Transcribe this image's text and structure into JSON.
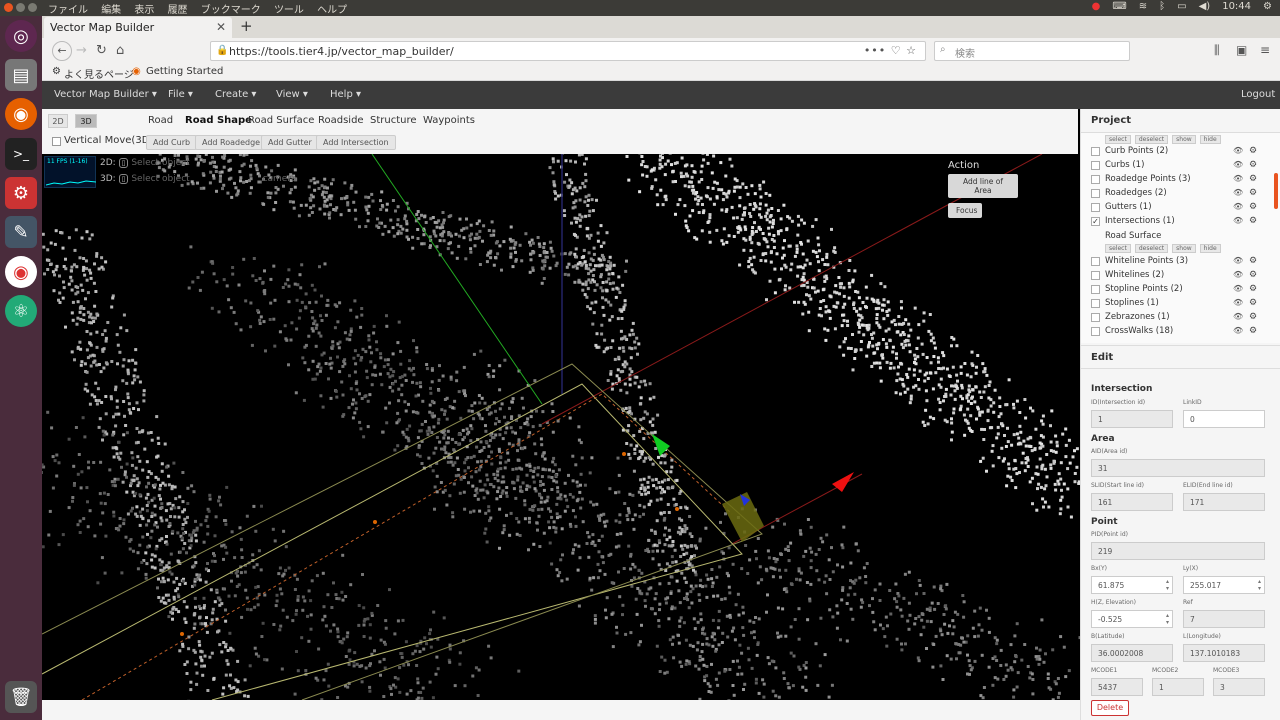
{
  "system": {
    "menu": [
      "ファイル",
      "編集",
      "表示",
      "履歴",
      "ブックマーク",
      "ツール",
      "ヘルプ"
    ],
    "time": "10:44"
  },
  "browser": {
    "tab_title": "Vector Map Builder",
    "url": "https://tools.tier4.jp/vector_map_builder/",
    "search_placeholder": "検索",
    "bookmarks": [
      "よく見るページ",
      "Getting Started"
    ]
  },
  "appnav": {
    "brand": "Vector Map Builder",
    "items": [
      "File",
      "Create",
      "View",
      "Help"
    ],
    "logout": "Logout"
  },
  "toolbar": {
    "view_2d": "2D",
    "view_3d": "3D",
    "tabs": [
      "Road",
      "Road Shape",
      "Road Surface",
      "Roadside",
      "Structure",
      "Waypoints"
    ],
    "active_tab": "Road Shape",
    "vertical_move": "Vertical Move(3D)",
    "sub_buttons": [
      "Add Curb",
      "Add Roadedge",
      "Add Gutter",
      "Add Intersection"
    ]
  },
  "viewport": {
    "fps": "11 FPS (1-16)",
    "hint_2d": "2D:",
    "hint_2d_text": "Select object",
    "hint_3d": "3D:",
    "hint_3d_text": "Select object",
    "hint_camera": "camera",
    "action_title": "Action",
    "action_buttons": [
      "Add line of Area",
      "Focus"
    ]
  },
  "project": {
    "title": "Project",
    "group_buttons": [
      "select",
      "deselect",
      "show",
      "hide"
    ],
    "items_top": [
      {
        "label": "Curb Points (2)",
        "checked": false
      },
      {
        "label": "Curbs (1)",
        "checked": false
      },
      {
        "label": "Roadedge Points (3)",
        "checked": false
      },
      {
        "label": "Roadedges (2)",
        "checked": false
      },
      {
        "label": "Gutters (1)",
        "checked": false
      },
      {
        "label": "Intersections (1)",
        "checked": true
      }
    ],
    "section2": "Road Surface",
    "items_bottom": [
      {
        "label": "Whiteline Points (3)",
        "checked": false
      },
      {
        "label": "Whitelines (2)",
        "checked": false
      },
      {
        "label": "Stopline Points (2)",
        "checked": false
      },
      {
        "label": "Stoplines (1)",
        "checked": false
      },
      {
        "label": "Zebrazones (1)",
        "checked": false
      },
      {
        "label": "CrossWalks (18)",
        "checked": false
      }
    ]
  },
  "edit": {
    "title": "Edit",
    "intersection": "Intersection",
    "id_label": "ID(Intersection id)",
    "id_value": "1",
    "linkid_label": "LinkID",
    "linkid_value": "0",
    "area": "Area",
    "aid_label": "AID(Area id)",
    "aid_value": "31",
    "slid_label": "SLID(Start line id)",
    "slid_value": "161",
    "elid_label": "ELID(End line id)",
    "elid_value": "171",
    "point": "Point",
    "pid_label": "PID(Point id)",
    "pid_value": "219",
    "bx_label": "Bx(Y)",
    "bx_value": "61.875",
    "ly_label": "Ly(X)",
    "ly_value": "255.017",
    "h_label": "H(Z, Elevation)",
    "h_value": "-0.525",
    "ref_label": "Ref",
    "ref_value": "7",
    "b_label": "B(Latitude)",
    "b_value": "36.0002008",
    "l_label": "L(Longitude)",
    "l_value": "137.1010183",
    "mcode1_label": "MCODE1",
    "mcode1_value": "5437",
    "mcode2_label": "MCODE2",
    "mcode2_value": "1",
    "mcode3_label": "MCODE3",
    "mcode3_value": "3",
    "delete": "Delete"
  }
}
